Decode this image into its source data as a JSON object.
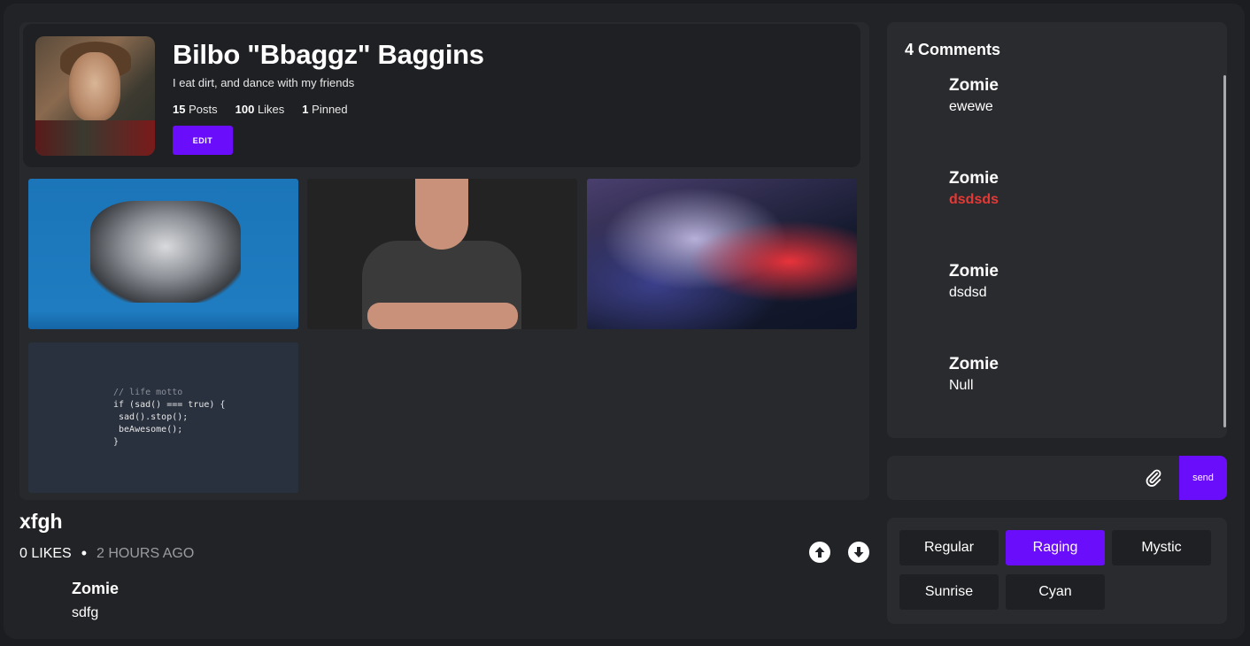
{
  "profile": {
    "name": "Bilbo \"Bbaggz\" Baggins",
    "bio": "I eat dirt, and dance with my friends",
    "stats": [
      {
        "value": "15",
        "label": "Posts"
      },
      {
        "value": "100",
        "label": "Likes"
      },
      {
        "value": "1",
        "label": "Pinned"
      }
    ],
    "edit_label": "EDIT"
  },
  "gallery": {
    "code_snippet": {
      "comment": "// life motto",
      "lines": "if (sad() === true) {\n sad().stop();\n beAwesome();\n}"
    }
  },
  "post": {
    "title": "xfgh",
    "likes": "0 LIKES",
    "separator": "•",
    "time": "2 HOURS AGO",
    "author": "Zomie",
    "body": "sdfg"
  },
  "comments": {
    "title": "4 Comments",
    "items": [
      {
        "author": "Zomie",
        "text": "ewewe"
      },
      {
        "author": "Zomie",
        "text": "dsdsds"
      },
      {
        "author": "Zomie",
        "text": "dsdsd"
      },
      {
        "author": "Zomie",
        "text": "Null"
      }
    ]
  },
  "composer": {
    "placeholder": "",
    "send_label": "send"
  },
  "themes": {
    "items": [
      "Regular",
      "Raging",
      "Mystic",
      "Sunrise",
      "Cyan"
    ],
    "active": "Raging"
  },
  "colors": {
    "accent": "#6a0dfb",
    "danger": "#e53935",
    "background": "#222326",
    "panel": "#2a2b2f"
  }
}
